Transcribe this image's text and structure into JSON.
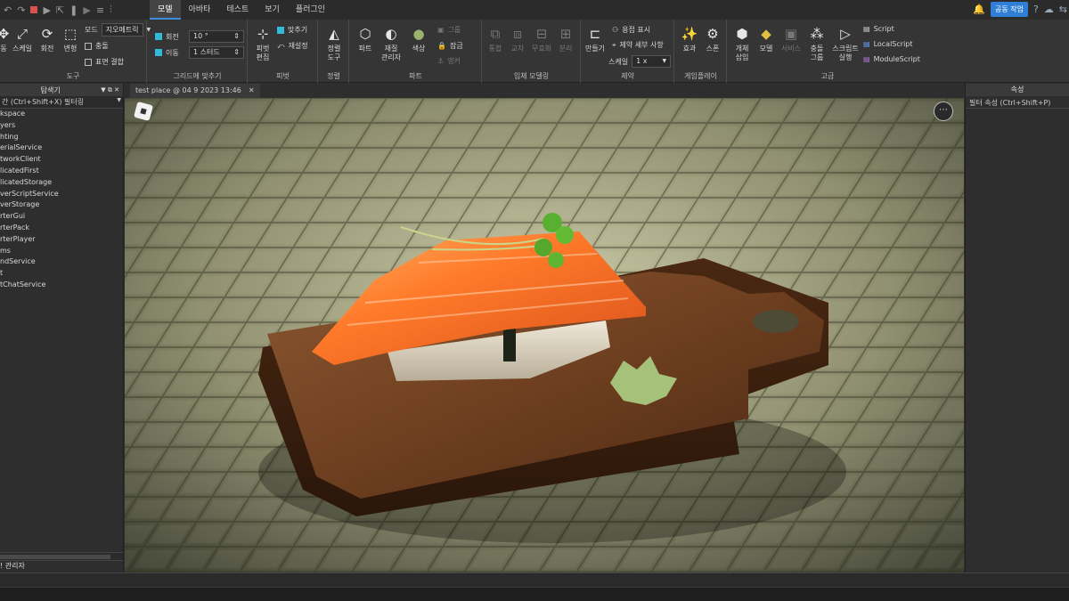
{
  "menubar": {
    "tabs": [
      {
        "label": "모델",
        "active": true
      },
      {
        "label": "아바타",
        "active": false
      },
      {
        "label": "테스트",
        "active": false
      },
      {
        "label": "보기",
        "active": false
      },
      {
        "label": "플러그인",
        "active": false
      }
    ],
    "collab_button": "공동 작업"
  },
  "ribbon": {
    "tools": {
      "label": "도구",
      "buttons": [
        "동",
        "스케일",
        "회전",
        "변형"
      ],
      "mode_label": "모드",
      "mode_value": "지오메트릭",
      "collision": "충돌",
      "surface_join": "표면 결합"
    },
    "snap": {
      "label": "그리드에 맞추기",
      "rotate_label": "회전",
      "rotate_value": "10 °",
      "move_label": "이동",
      "move_value": "1 스터드"
    },
    "pivot": {
      "label": "피벗",
      "edit": "피벗\n편집",
      "snap": "맞추기",
      "reset": "재설정"
    },
    "align": {
      "label": "정렬",
      "tool": "정렬\n도구"
    },
    "part": {
      "label": "파트",
      "part": "파트",
      "material": "재질\n관리자",
      "color": "색상",
      "group": "그룹",
      "lock": "잠금",
      "anchor": "앵커"
    },
    "solid": {
      "label": "입체 모델링",
      "union": "통합",
      "intersect": "교차",
      "negate": "무효화",
      "separate": "분리"
    },
    "constraints": {
      "label": "제약",
      "create": "만들기",
      "weld": "용접 표시",
      "details": "제약 세부 사항",
      "scale_label": "스케일",
      "scale_value": "1 x"
    },
    "gameplay": {
      "label": "게임플레이",
      "effects": "효과",
      "spawn": "스폰"
    },
    "advanced": {
      "label": "고급",
      "insert": "개체\n삽입",
      "model": "모델",
      "service": "서비스",
      "collision_groups": "충돌\n그룹",
      "run_script": "스크립트\n실행",
      "scripts": [
        "Script",
        "LocalScript",
        "ModuleScript"
      ]
    }
  },
  "explorer": {
    "title": "탐색기",
    "filter": "간 (Ctrl+Shift+X) 필터링",
    "items": [
      "kspace",
      "yers",
      "hting",
      "erialService",
      "tworkClient",
      "licatedFirst",
      "licatedStorage",
      "verScriptService",
      "verStorage",
      "rterGui",
      "rterPack",
      "rterPlayer",
      "ms",
      "ndService",
      "t",
      "tChatService"
    ],
    "bottom_tab": "! 관리자"
  },
  "viewport": {
    "tab_title": "test place @ 04 9 2023 13:46"
  },
  "properties": {
    "title": "속성",
    "filter": "필터 속성 (Ctrl+Shift+P)"
  },
  "colors": {
    "accent": "#3b8de0",
    "collab": "#2f7fd6",
    "stop": "#d9534f",
    "checkbox": "#34b9d8"
  }
}
